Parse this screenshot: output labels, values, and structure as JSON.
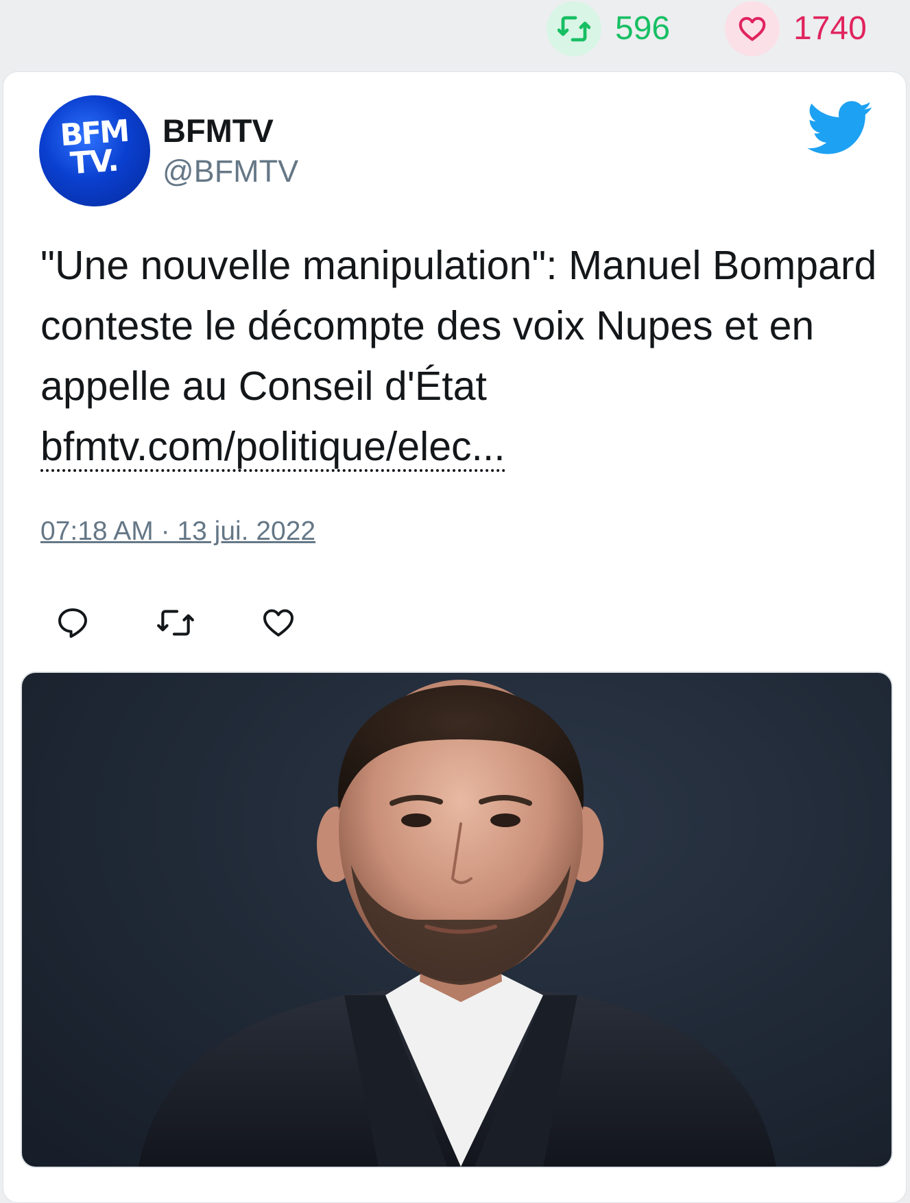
{
  "stats": {
    "retweets": "596",
    "likes": "1740",
    "retweet_icon": "retweet-icon",
    "like_icon": "heart-icon",
    "retweet_color": "#17bf63",
    "like_color": "#e0245e"
  },
  "tweet": {
    "author_name": "BFMTV",
    "author_handle": "@BFMTV",
    "avatar_text": "BFM TV.",
    "text": "\"Une nouvelle manipulation\": Manuel Bompard conteste le décompte des voix Nupes et en appelle au Conseil d'État",
    "link": "bfmtv.com/politique/elec...",
    "timestamp": "07:18 AM · 13 jui. 2022",
    "brand_icon": "twitter-bird-icon",
    "brand_color": "#1da1f2"
  },
  "actions": {
    "reply_icon": "reply-icon",
    "retweet_icon": "retweet-icon",
    "like_icon": "heart-icon"
  },
  "media": {
    "description_icon": "photo"
  }
}
